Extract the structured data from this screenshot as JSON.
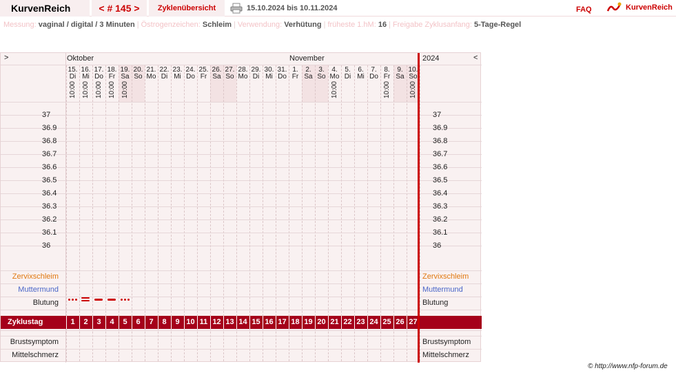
{
  "header": {
    "app_title": "KurvenReich",
    "cycle_nav": "< # 145 >",
    "overview_tab": "Zyklenübersicht",
    "date_range": "15.10.2024 bis 10.11.2024",
    "faq": "FAQ",
    "logo_text": "KurvenReich"
  },
  "settings": [
    {
      "label": "Messung:",
      "value": "vaginal / digital / 3 Minuten"
    },
    {
      "label": "Östrogenzeichen:",
      "value": "Schleim"
    },
    {
      "label": "Verwendung:",
      "value": "Verhütung"
    },
    {
      "label": "früheste 1.hM:",
      "value": "16"
    },
    {
      "label": "Freigabe Zyklusanfang:",
      "value": "5-Tage-Regel"
    }
  ],
  "chart": {
    "left_arrow": ">",
    "right_arrow": "<",
    "months": [
      "Oktober",
      "November"
    ],
    "year": "2024",
    "days": [
      {
        "d": "15.",
        "w": "Di",
        "t": "10:00"
      },
      {
        "d": "16.",
        "w": "Mi",
        "t": "10:00"
      },
      {
        "d": "17.",
        "w": "Do",
        "t": "10:00"
      },
      {
        "d": "18.",
        "w": "Fr",
        "t": "10:00"
      },
      {
        "d": "19.",
        "w": "Sa",
        "t": "10:00",
        "we": true
      },
      {
        "d": "20.",
        "w": "So",
        "t": "",
        "we": true
      },
      {
        "d": "21.",
        "w": "Mo",
        "t": ""
      },
      {
        "d": "22.",
        "w": "Di",
        "t": ""
      },
      {
        "d": "23.",
        "w": "Mi",
        "t": ""
      },
      {
        "d": "24.",
        "w": "Do",
        "t": ""
      },
      {
        "d": "25.",
        "w": "Fr",
        "t": ""
      },
      {
        "d": "26.",
        "w": "Sa",
        "t": "",
        "we": true
      },
      {
        "d": "27.",
        "w": "So",
        "t": "",
        "we": true
      },
      {
        "d": "28.",
        "w": "Mo",
        "t": ""
      },
      {
        "d": "29.",
        "w": "Di",
        "t": ""
      },
      {
        "d": "30.",
        "w": "Mi",
        "t": ""
      },
      {
        "d": "31.",
        "w": "Do",
        "t": ""
      },
      {
        "d": "1.",
        "w": "Fr",
        "t": ""
      },
      {
        "d": "2.",
        "w": "Sa",
        "t": "",
        "we": true
      },
      {
        "d": "3.",
        "w": "So",
        "t": "",
        "we": true
      },
      {
        "d": "4.",
        "w": "Mo",
        "t": "10:00"
      },
      {
        "d": "5.",
        "w": "Di",
        "t": ""
      },
      {
        "d": "6.",
        "w": "Mi",
        "t": ""
      },
      {
        "d": "7.",
        "w": "Do",
        "t": ""
      },
      {
        "d": "8.",
        "w": "Fr",
        "t": "10:00"
      },
      {
        "d": "9.",
        "w": "Sa",
        "t": "",
        "we": true
      },
      {
        "d": "10.",
        "w": "So",
        "t": "10:00",
        "we": true
      }
    ],
    "temperatures": [
      "37",
      "36.9",
      "36.8",
      "36.7",
      "36.6",
      "36.5",
      "36.4",
      "36.3",
      "36.2",
      "36.1",
      "36"
    ],
    "rows": {
      "zervix": "Zervixschleim",
      "muttermund": "Muttermund",
      "blutung": "Blutung",
      "zyklustag": "Zyklustag",
      "brust": "Brustsymptom",
      "mittel": "Mittelschmerz"
    },
    "bleeding": [
      "light",
      "heavy",
      "medium",
      "medium",
      "light"
    ],
    "cycle_days": [
      "1",
      "2",
      "3",
      "4",
      "5",
      "6",
      "7",
      "8",
      "9",
      "10",
      "11",
      "12",
      "13",
      "14",
      "15",
      "16",
      "17",
      "18",
      "19",
      "20",
      "21",
      "22",
      "23",
      "24",
      "25",
      "26",
      "27"
    ]
  },
  "footer": "© http://www.nfp-forum.de",
  "colors": {
    "accent": "#cc0000",
    "cycle_bar": "#a5001a",
    "zervix": "#e07810",
    "muttermund": "#4a66c8"
  }
}
